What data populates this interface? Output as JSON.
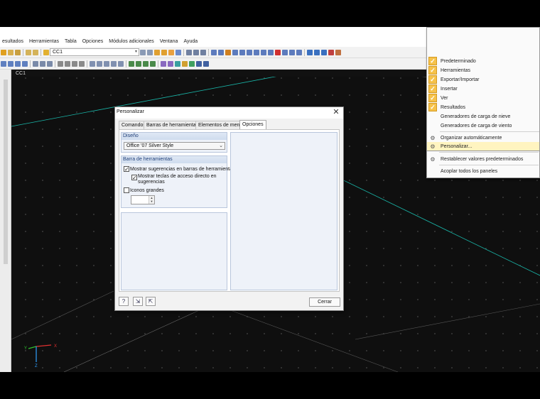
{
  "menubar": [
    "esultados",
    "Herramientas",
    "Tabla",
    "Opciones",
    "Módulos adicionales",
    "Ventana",
    "Ayuda"
  ],
  "toolbar": {
    "load_case_value": "CC1"
  },
  "workspace": {
    "tab_label": "CC1",
    "axes": {
      "x": "X",
      "y": "Y",
      "z": "Z"
    }
  },
  "context_menu": {
    "checked_items": [
      "Predeterminado",
      "Herramientas",
      "Exportar/Importar",
      "Insertar",
      "Ver",
      "Resultados"
    ],
    "unchecked_items": [
      "Generadores de carga de nieve",
      "Generadores de carga de viento"
    ],
    "organize": "Organizar automáticamente",
    "customize": "Personalizar...",
    "reset": "Restablecer valores predeterminados",
    "dock_all": "Acoplar todos los paneles"
  },
  "dialog": {
    "title": "Personalizar",
    "tabs": [
      "Comandos",
      "Barras de herramientas",
      "Elementos de menú",
      "Opciones"
    ],
    "active_tab": "Opciones",
    "design_group": {
      "header": "Diseño",
      "style_value": "Office '07 Silver Style"
    },
    "toolbar_group": {
      "header": "Barra de herramientas",
      "show_tooltips": {
        "label": "Mostrar sugerencias en barras de herramientas",
        "checked": true
      },
      "show_shortcuts": {
        "label_line1": "Mostrar teclas de acceso directo en",
        "label_line2": "sugerencias",
        "checked": true
      },
      "large_icons": {
        "label": "Iconos grandes",
        "checked": false
      }
    },
    "close_label": "Cerrar"
  },
  "colors": {
    "check_orange": "#f6c24a",
    "group_header": "#1e3e77",
    "axis_x": "#e03030",
    "axis_y": "#30c030",
    "axis_z": "#30a0ff",
    "grid_lines": "#19b5a8"
  }
}
